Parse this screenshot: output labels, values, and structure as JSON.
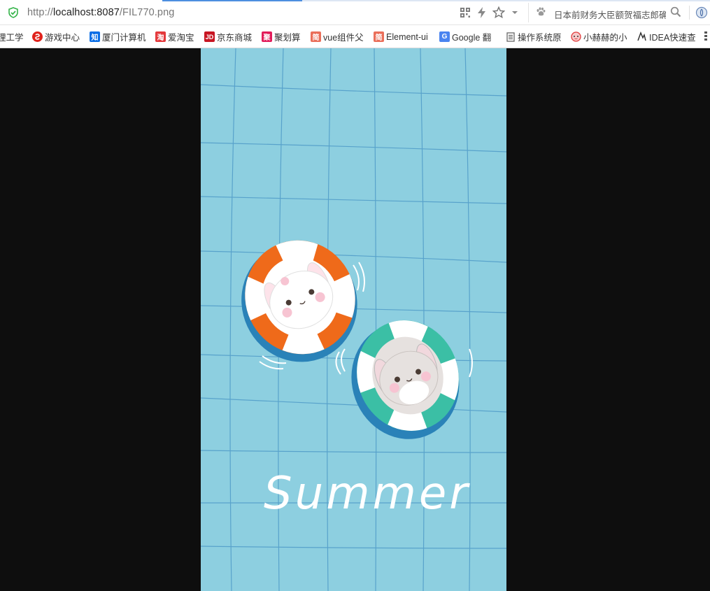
{
  "browser": {
    "url_scheme": "http://",
    "url_host": "localhost:8087",
    "url_path": "/FIL770.png",
    "search_text": "日本前财务大臣额贺福志郎确",
    "icons": {
      "security": "shield-check-icon",
      "qr": "qr-code-icon",
      "speed": "lightning-icon",
      "favorite": "star-icon",
      "dropdown": "chevron-down-icon",
      "search_engine": "paw-icon",
      "search": "search-icon",
      "extension": "globe-icon"
    }
  },
  "bookmarks": [
    {
      "label": "理工学",
      "icon": "none"
    },
    {
      "label": "游戏中心",
      "icon": "game-center-icon",
      "color": "#e0221b"
    },
    {
      "label": "厦门计算机",
      "icon": "zhihu-icon",
      "glyph": "知",
      "color": "#0a6ee6"
    },
    {
      "label": "爱淘宝",
      "icon": "taobao-icon",
      "glyph": "淘",
      "color": "#e4393c"
    },
    {
      "label": "京东商城",
      "icon": "jd-icon",
      "glyph": "JD",
      "color": "#c81623"
    },
    {
      "label": "聚划算",
      "icon": "juhuasuan-icon",
      "glyph": "聚",
      "color": "#e21c5a"
    },
    {
      "label": "vue组件父",
      "icon": "jianshu-icon",
      "glyph": "简",
      "color": "#ea6f5a"
    },
    {
      "label": "Element-ui",
      "icon": "jianshu-icon",
      "glyph": "简",
      "color": "#ea6f5a"
    },
    {
      "label": "Google 翻",
      "icon": "google-translate-icon",
      "glyph": "G",
      "color": "#4a84f0"
    },
    {
      "label": "操作系统原",
      "icon": "document-icon",
      "color": "#666666"
    },
    {
      "label": "小赫赫的小",
      "icon": "bilibili-face-icon",
      "color": "#e23b3b"
    },
    {
      "label": "IDEA快速查",
      "icon": "idea-icon",
      "color": "#333333"
    }
  ],
  "image": {
    "caption": "Summer",
    "background": "#8dcfe0",
    "float_colors": [
      "#ef6a1a",
      "#3bbfa5"
    ]
  }
}
